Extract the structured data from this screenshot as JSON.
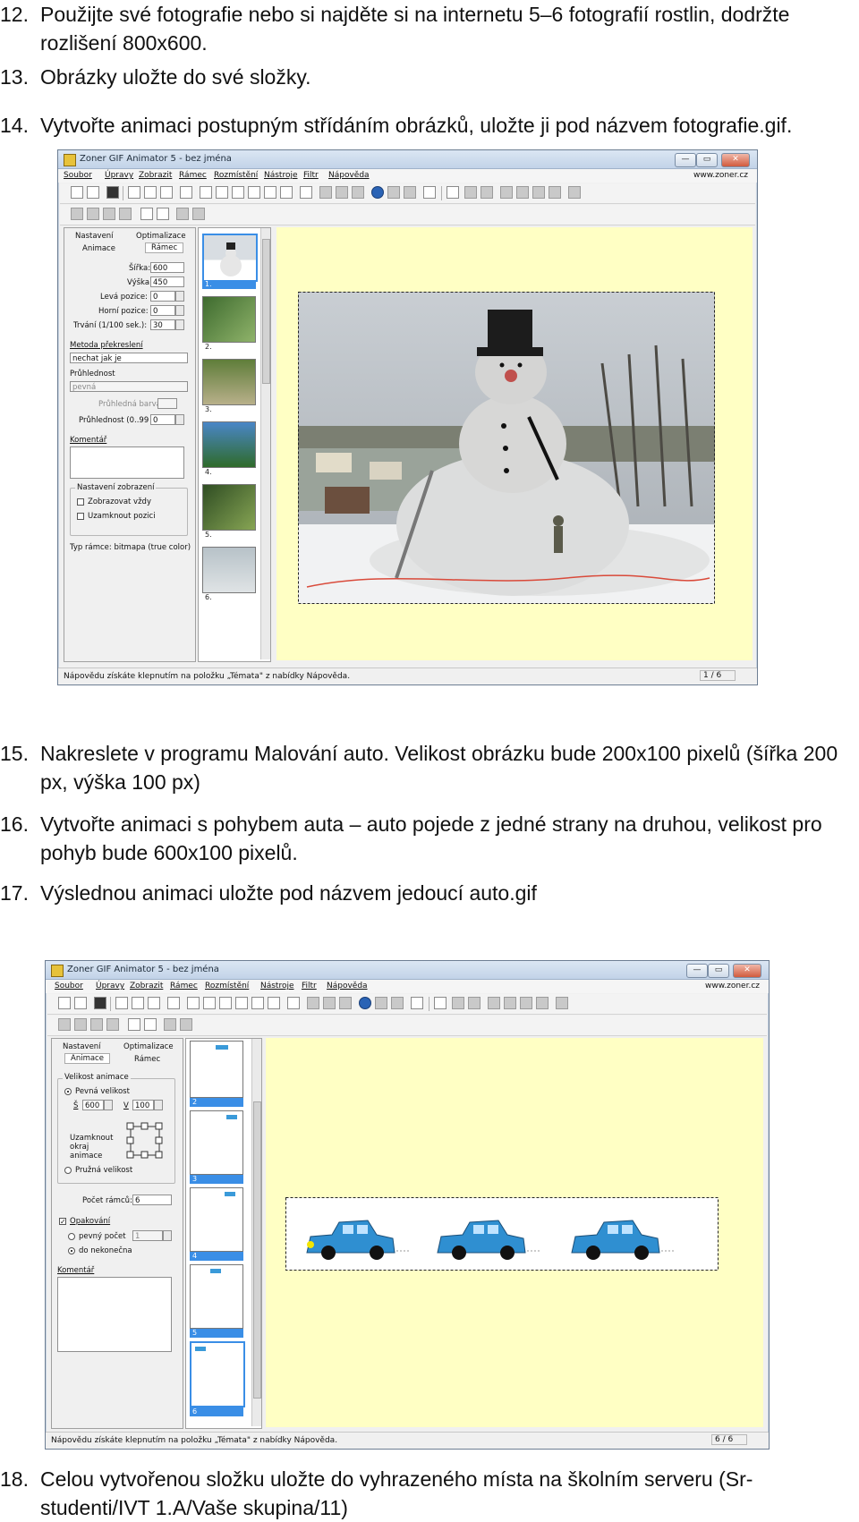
{
  "steps": [
    {
      "num": "12.",
      "text": "Použijte své fotografie nebo si najděte si na internetu 5–6 fotografií rostlin, dodržte rozlišení 800x600."
    },
    {
      "num": "13.",
      "text": "Obrázky uložte do své složky."
    },
    {
      "num": "14.",
      "text": "Vytvořte animaci postupným střídáním obrázků, uložte ji pod názvem fotografie.gif."
    },
    {
      "num": "15.",
      "text": "Nakreslete v programu Malování auto. Velikost obrázku bude 200x100 pixelů (šířka 200 px, výška 100 px)"
    },
    {
      "num": "16.",
      "text": "Vytvořte animaci s pohybem auta – auto pojede z jedné strany na druhou, velikost pro pohyb bude 600x100 pixelů."
    },
    {
      "num": "17.",
      "text": "Výslednou animaci uložte pod názvem jedoucí auto.gif"
    },
    {
      "num": "18.",
      "text": "Celou vytvořenou složku uložte do vyhrazeného místa na školním serveru (Sr-studenti/IVT 1.A/Vaše skupina/11)"
    }
  ],
  "app": {
    "title": "Zoner GIF Animator 5 - bez jména",
    "menu": [
      "Soubor",
      "Úpravy",
      "Zobrazit",
      "Rámec",
      "Rozmístění",
      "Nástroje",
      "Filtr",
      "Nápověda"
    ],
    "site": "www.zoner.cz",
    "win_buttons": {
      "minimize": "—",
      "maximize": "▭",
      "close": "✕"
    },
    "status_text": "Nápovědu získáte klepnutím na položku „Témata\" z nabídky Nápověda.",
    "tabs": {
      "nastaveni": "Nastavení",
      "optimalizace": "Optimalizace",
      "animace": "Animace",
      "ramec": "Rámec"
    }
  },
  "shot1": {
    "fields": [
      {
        "label": "Šířka:",
        "value": "600"
      },
      {
        "label": "Výška:",
        "value": "450"
      },
      {
        "label": "Levá pozice:",
        "value": "0"
      },
      {
        "label": "Horní pozice:",
        "value": "0"
      },
      {
        "label": "Trvání (1/100 sek.):",
        "value": "30"
      }
    ],
    "redraw_label": "Metoda překreslení",
    "redraw_value": "nechat jak je",
    "transparency_label": "Průhlednost",
    "transparency_value": "pevná",
    "transparent_color_btn": "Průhledná barva",
    "opacity_label": "Průhlednost (0..99 %):",
    "opacity_value": "0",
    "comment_label": "Komentář",
    "view_group": "Nastavení zobrazení",
    "always_show": "Zobrazovat vždy",
    "lock_pos": "Uzamknout pozici",
    "frame_type": "Typ rámce:  bitmapa (true color)",
    "frames": [
      "1.",
      "2.",
      "3.",
      "4.",
      "5.",
      "6."
    ],
    "page": "1 / 6"
  },
  "shot2": {
    "size_group": "Velikost animace",
    "fixed": "Pevná velikost",
    "w_label": "Š",
    "w_value": "600",
    "h_label": "V",
    "h_value": "100",
    "lock_edge": "Uzamknout okraj animace",
    "flex": "Pružná velikost",
    "frame_count_label": "Počet rámců:",
    "frame_count": "6",
    "repeat": "Opakování",
    "fixed_count": "pevný počet",
    "fixed_count_value": "1",
    "forever": "do nekonečna",
    "comment_label": "Komentář",
    "frames": [
      "2",
      "3",
      "4",
      "5",
      "6"
    ],
    "page": "6 / 6"
  }
}
